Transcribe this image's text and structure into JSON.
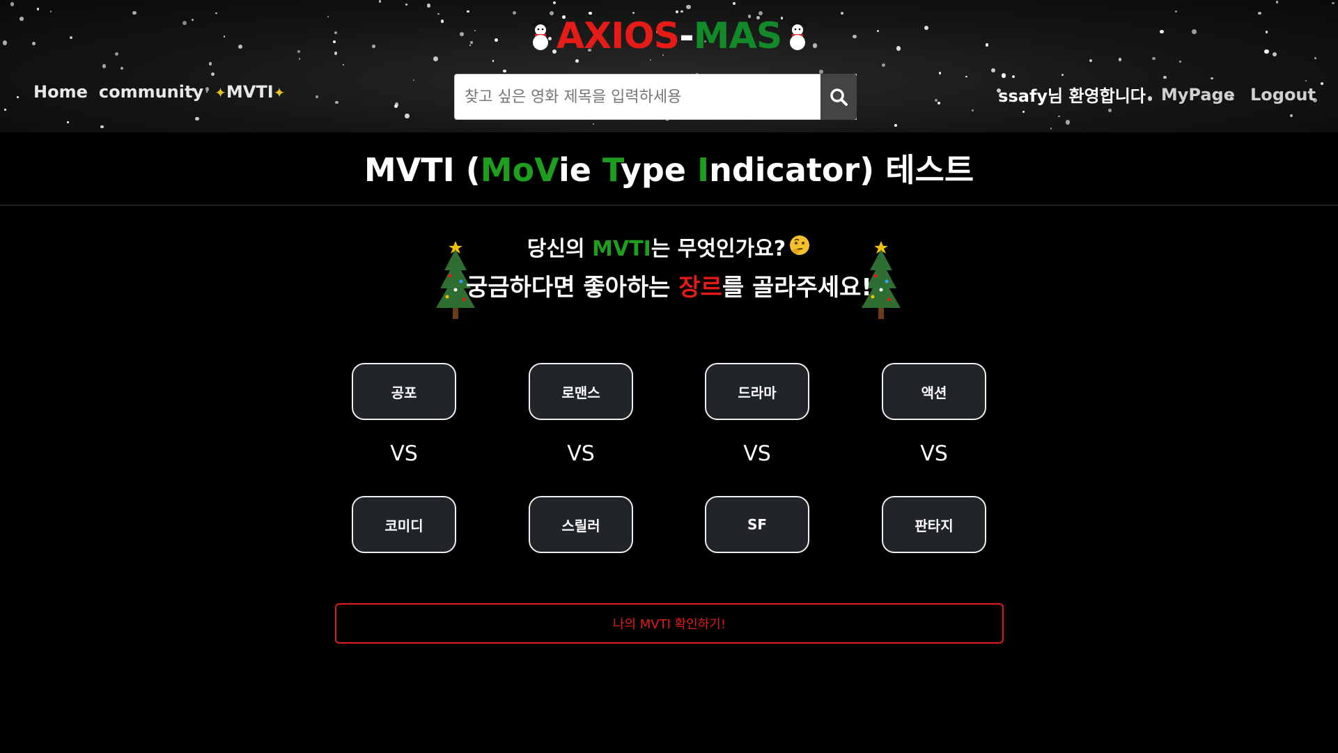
{
  "header": {
    "logo": {
      "part1": "AXIOS",
      "dash": "-",
      "part2": "MAS"
    },
    "nav_left": {
      "home": "Home",
      "community": "community",
      "mvti": "MVTI"
    },
    "search": {
      "placeholder": "찾고 싶은 영화 제목을 입력하세용"
    },
    "nav_right": {
      "welcome": "ssafy님 환영합니다",
      "mypage": "MyPage",
      "logout": "Logout"
    }
  },
  "title": {
    "prefix": "MVTI (",
    "m": "M",
    "o": "o",
    "v": "V",
    "ie": "ie ",
    "t": "T",
    "ype": "ype ",
    "i": "I",
    "ndicator": "ndicator) ",
    "suffix": "테스트"
  },
  "question": {
    "line1_pre": "당신의 ",
    "line1_mvti": "MVTI",
    "line1_post": "는 무엇인가요?",
    "line2_pre": "궁금하다면 좋아하는 ",
    "line2_genre": "장르",
    "line2_post": "를 골라주세요!"
  },
  "genres": {
    "top": [
      "공포",
      "로맨스",
      "드라마",
      "액션"
    ],
    "vs": "VS",
    "bottom": [
      "코미디",
      "스릴러",
      "SF",
      "판타지"
    ]
  },
  "submit_label": "나의 MVTI 확인하기!",
  "colors": {
    "red": "#e41b17",
    "green": "#1e9e1e",
    "button_bg": "#212529"
  }
}
